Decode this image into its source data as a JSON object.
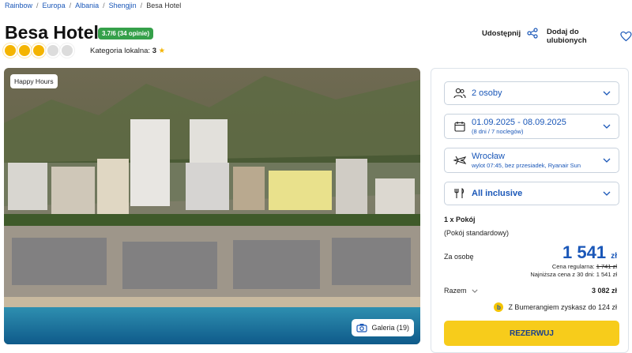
{
  "breadcrumb": [
    "Rainbow",
    "Europa",
    "Albania",
    "Shengjin",
    "Besa Hotel"
  ],
  "hotel": {
    "name": "Besa Hotel",
    "rating": "3.7/6",
    "reviews": "(34 opinie)",
    "stars_filled": 3,
    "stars_total": 5,
    "local_category_label": "Kategoria lokalna:",
    "local_category_value": "3"
  },
  "actions": {
    "share": "Udostępnij",
    "favorite": "Dodaj do ulubionych"
  },
  "photo": {
    "badge": "Happy Hours",
    "gallery_label": "Galeria (19)"
  },
  "booking": {
    "persons": "2 osoby",
    "dates": "01.09.2025 - 08.09.2025",
    "dates_sub": "(8 dni / 7 noclegów)",
    "departure": "Wrocław",
    "departure_sub": "wylot 07:45, bez przesiadek, Ryanair Sun",
    "board": "All inclusive",
    "room_count": "1 x Pokój",
    "room_type": "(Pokój standardowy)",
    "per_person_label": "Za osobę",
    "price": "1 541",
    "currency": "zł",
    "regular_label": "Cena regularna:",
    "regular_price": "1 741 zł",
    "lowest_label": "Najniższa cena z 30 dni: 1 541 zł",
    "total_label": "Razem",
    "total": "3 082 zł",
    "bumerang": "Z Bumerangiem zyskasz do 124 zł",
    "reserve": "REZERWUJ"
  },
  "colors": {
    "accent": "#1a57b8",
    "rating_bg": "#35a04a",
    "button": "#f7cc1b",
    "star": "#f4b400"
  }
}
